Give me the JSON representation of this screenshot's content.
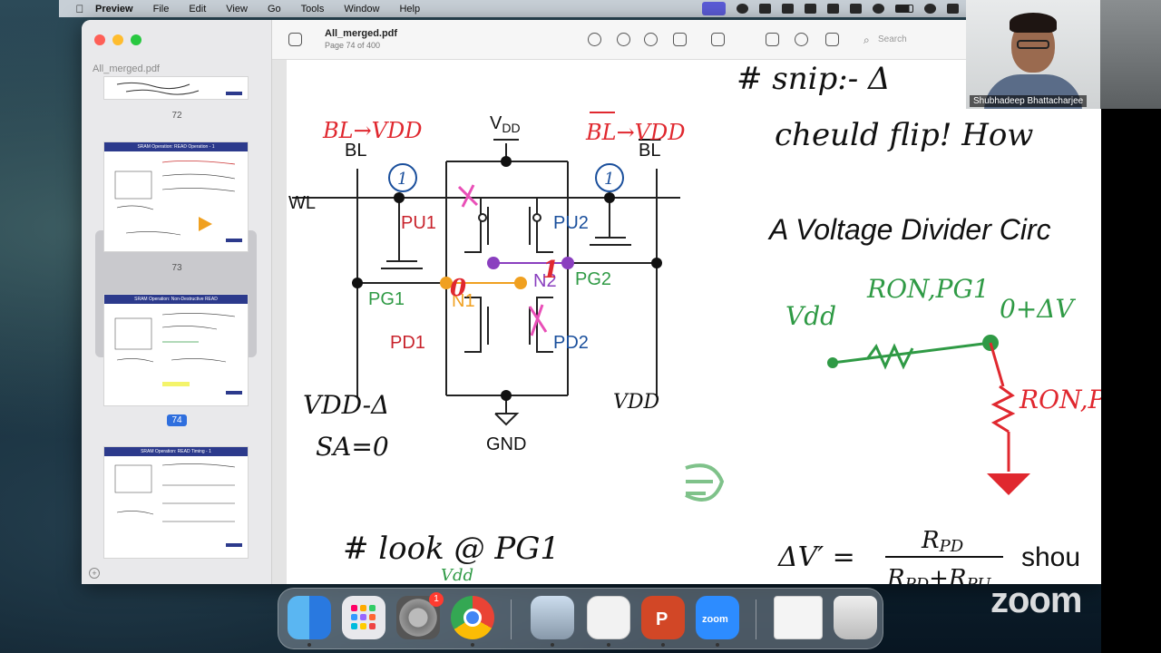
{
  "menubar": {
    "app": "Preview",
    "items": [
      "File",
      "Edit",
      "View",
      "Go",
      "Tools",
      "Window",
      "Help"
    ]
  },
  "sidebar": {
    "title": "All_merged.pdf",
    "thumbs": [
      {
        "page": "72"
      },
      {
        "page": "73",
        "heading": "SRAM Operation: READ Operation - 1"
      },
      {
        "page": "74",
        "heading": "SRAM Operation: Non-Destructive READ"
      },
      {
        "page": "",
        "heading": "SRAM Operation: READ Timing - 1"
      }
    ]
  },
  "toolbar": {
    "doc_title": "All_merged.pdf",
    "page_info": "Page 74 of 400",
    "search_placeholder": "Search"
  },
  "slide": {
    "labels": {
      "vdd": "V",
      "vdd_sub": "DD",
      "bl": "BL",
      "blb": "BL",
      "wl": "WL",
      "pu1": "PU1",
      "pu2": "PU2",
      "pg1": "PG1",
      "pg2": "PG2",
      "n1": "N1",
      "n2": "N2",
      "pd1": "PD1",
      "pd2": "PD2",
      "gnd": "GND",
      "one_left": "1",
      "one_right": "1",
      "zero": "0",
      "one_node": "1"
    },
    "handwriting": {
      "bl_vdd": "BL→VDD",
      "blb_vdd": "BL→VDD",
      "vdd_delta": "VDD-Δ",
      "sa_zero": "SA=0",
      "vdd_right": "VDD",
      "look": "# look @ PG1",
      "vdd_small": "Vdd",
      "top_right": "# snip:- Δ",
      "flip": "cheuld flip! How",
      "vdd_div": "Vdd",
      "ron_pg": "RON,PG1",
      "node_val": "0+ΔV",
      "ron_pd": "RON,P"
    },
    "heading": "A Voltage Divider Circ",
    "formula": {
      "lhs": "ΔV′ =",
      "num": "R",
      "num_sub": "PD",
      "den": "R",
      "den_sub1": "PD",
      "den_plus": "+R",
      "den_sub2": "PU",
      "tail": "shou"
    }
  },
  "webcam": {
    "name": "Shubhadeep Bhattacharjee"
  },
  "dock": {
    "items": [
      "Finder",
      "Launchpad",
      "System Settings",
      "Chrome",
      "Preview",
      "Screenshot",
      "PowerPoint",
      "Zoom",
      "Chrome Window",
      "Trash"
    ],
    "badge": "1",
    "zoom_label": "zoom"
  },
  "overlay": {
    "zoom_logo": "zoom"
  },
  "colors": {
    "red_ink": "#e0282f",
    "blue_ink": "#1a4f9c",
    "green_ink": "#2f9a45",
    "purple": "#8a3fbf",
    "orange": "#f0a020",
    "pink": "#e94fb7"
  }
}
